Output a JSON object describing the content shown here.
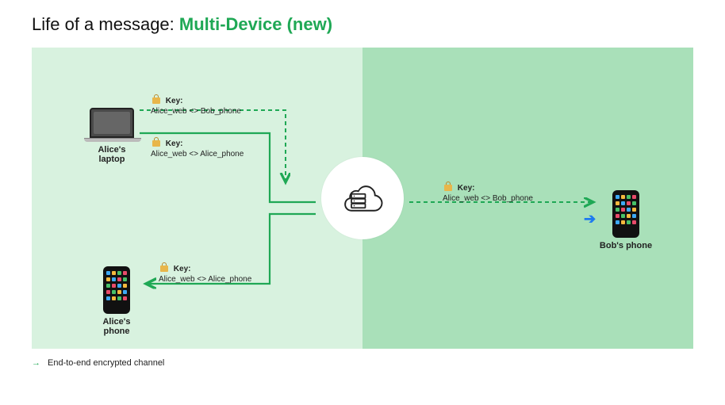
{
  "title": {
    "prefix": "Life of a message: ",
    "emph": "Multi-Device (new)"
  },
  "devices": {
    "alice_laptop": "Alice's laptop",
    "alice_phone": "Alice's phone",
    "bob_phone": "Bob's phone"
  },
  "keys": {
    "k1": {
      "heading": "Key:",
      "pair": "Alice_web <> Bob_phone"
    },
    "k2": {
      "heading": "Key:",
      "pair": "Alice_web <> Alice_phone"
    },
    "k3": {
      "heading": "Key:",
      "pair": "Alice_web <> Alice_phone"
    },
    "k4": {
      "heading": "Key:",
      "pair": "Alice_web <> Bob_phone"
    }
  },
  "legend": "End-to-end encrypted channel",
  "colors": {
    "accent": "#1fa855",
    "dashed": "#1fa855"
  }
}
